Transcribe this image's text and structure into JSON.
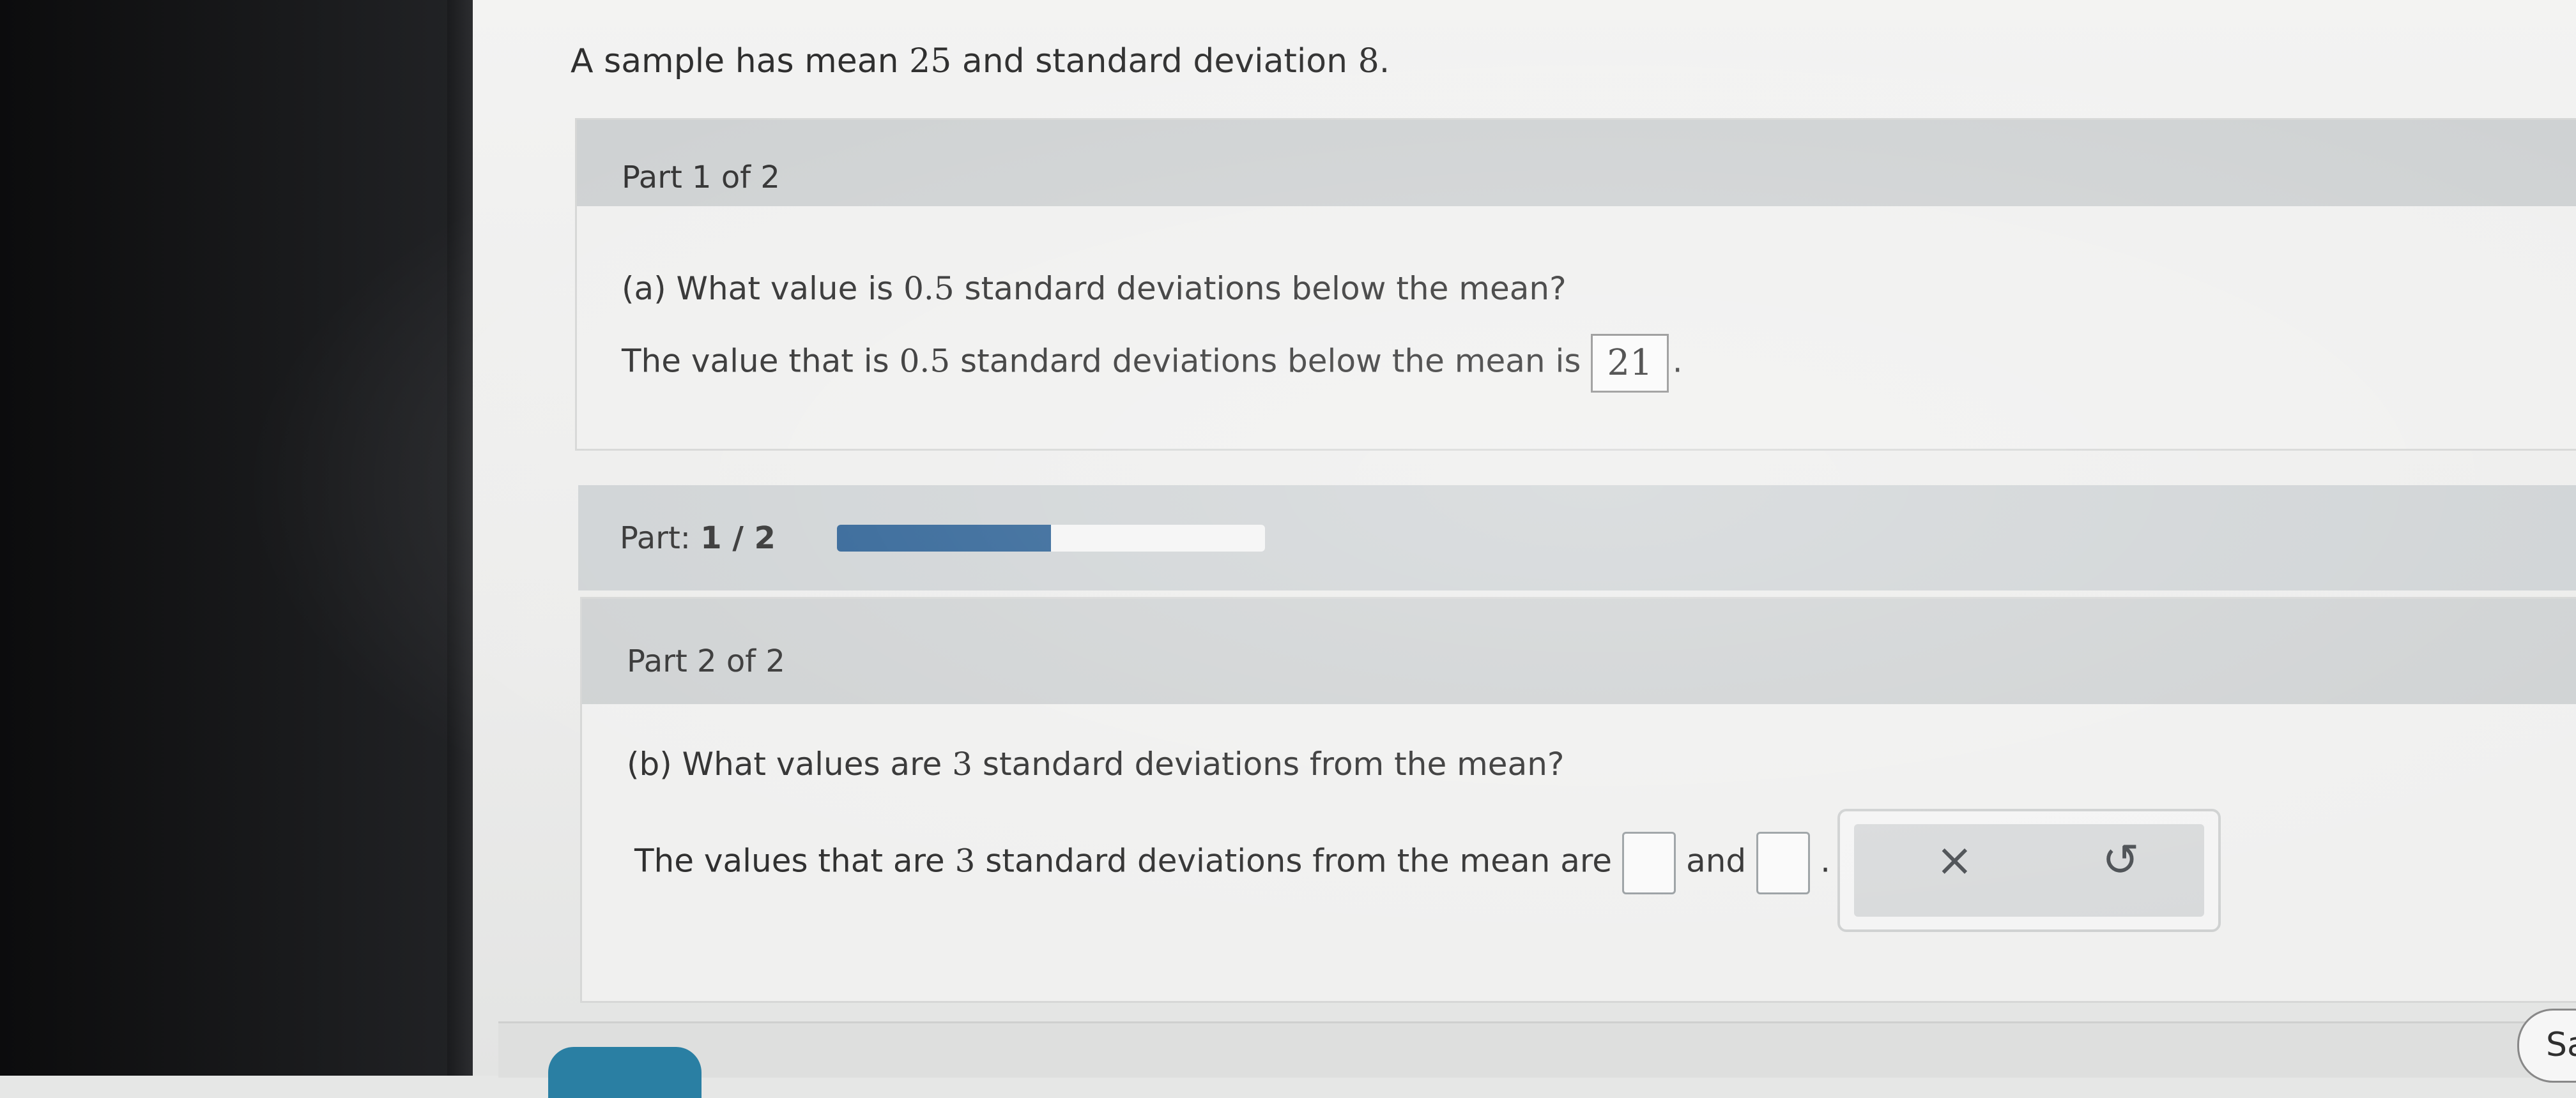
{
  "intro": {
    "text_a": "A sample has mean ",
    "mean": "25",
    "text_b": " and standard deviation ",
    "sd": "8",
    "text_c": "."
  },
  "part1": {
    "header": "Part 1 of 2",
    "question_a": "(a) What value is ",
    "question_num": "0.5",
    "question_b": " standard deviations below the mean?",
    "answer_prefix_a": "The value that is ",
    "answer_prefix_num": "0.5",
    "answer_prefix_b": " standard deviations below the mean is",
    "answer_value": "21",
    "answer_suffix": "."
  },
  "progress": {
    "label": "Part:",
    "value": "1 / 2",
    "fraction": 0.5
  },
  "part2": {
    "header": "Part 2 of 2",
    "question_a": "(b) What values are ",
    "question_num": "3",
    "question_b": " standard deviations from the mean?",
    "answer_prefix_a": "The values that are ",
    "answer_prefix_num": "3",
    "answer_prefix_b": " standard deviations from the mean are",
    "answer_joiner": "and",
    "answer_suffix": "."
  },
  "tools": {
    "clear_icon": "×",
    "undo_icon": "↺"
  },
  "footer": {
    "save_label": "Sa"
  },
  "colors": {
    "progress_fill": "#2a5f93",
    "header_band": "#cfd2d3",
    "next_button": "#2a7fa3"
  }
}
